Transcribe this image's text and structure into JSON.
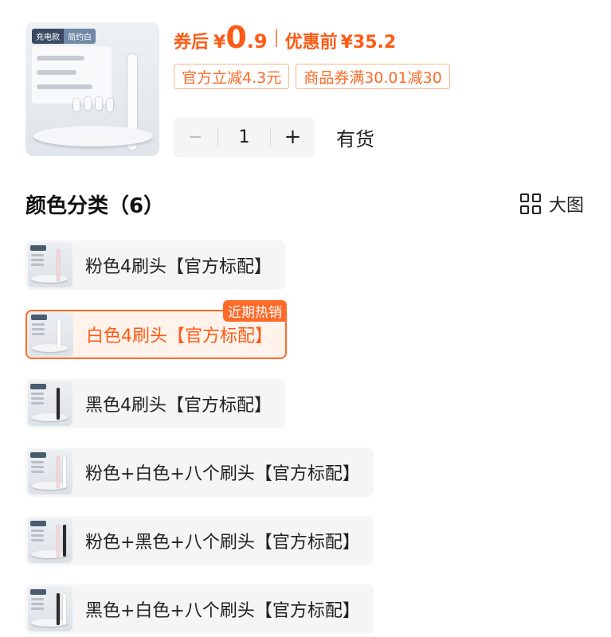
{
  "product": {
    "image_tags": [
      "充电款",
      "简约白"
    ],
    "price_label": "券后",
    "currency": "¥",
    "price_int": "0",
    "price_dec": ".9",
    "orig_label": "优惠前",
    "orig_price": "¥35.2",
    "coupons": [
      "官方立减4.3元",
      "商品券满30.01减30"
    ],
    "quantity": "1",
    "minus": "−",
    "plus": "+",
    "stock": "有货"
  },
  "section": {
    "title": "颜色分类（6）",
    "big_view": "大图"
  },
  "variants": [
    {
      "label": "粉色4刷头【官方标配】",
      "selected": false,
      "brush_colors": [
        "#f4d6da"
      ]
    },
    {
      "label": "白色4刷头【官方标配】",
      "selected": true,
      "badge": "近期热销",
      "brush_colors": [
        "#ffffff"
      ]
    },
    {
      "label": "黑色4刷头【官方标配】",
      "selected": false,
      "brush_colors": [
        "#2b2b2b"
      ]
    },
    {
      "label": "粉色+白色+八个刷头【官方标配】",
      "selected": false,
      "brush_colors": [
        "#f4d6da",
        "#ffffff"
      ]
    },
    {
      "label": "粉色+黑色+八个刷头【官方标配】",
      "selected": false,
      "brush_colors": [
        "#f4d6da",
        "#2b2b2b"
      ]
    },
    {
      "label": "黑色+白色+八个刷头【官方标配】",
      "selected": false,
      "brush_colors": [
        "#2b2b2b",
        "#ffffff"
      ]
    }
  ],
  "colors": {
    "accent": "#ff5a14",
    "selected_bg": "#fff3ec",
    "option_bg": "#f5f5f5"
  }
}
